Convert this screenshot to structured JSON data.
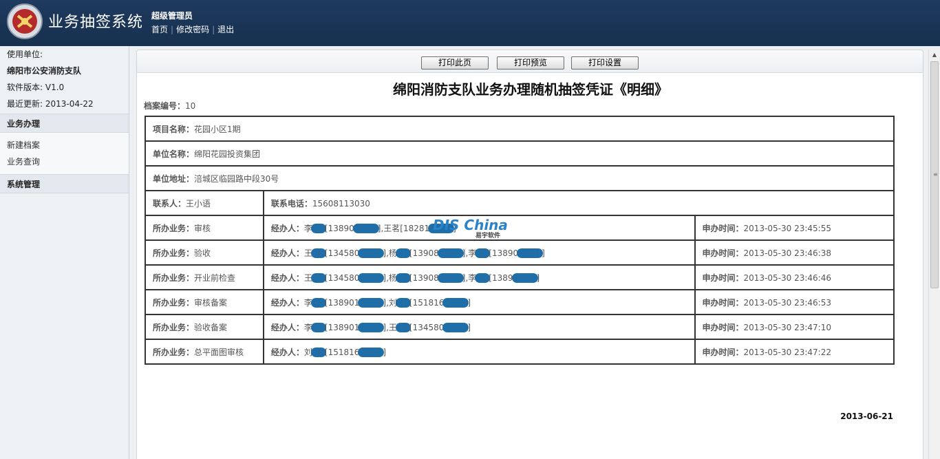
{
  "header": {
    "app_title": "业务抽签系统",
    "user_role": "超级管理员",
    "links": [
      "首页",
      "修改密码",
      "退出"
    ],
    "bg_color": "#1f3a5f"
  },
  "sidebar": {
    "unit_label": "使用单位:",
    "unit_name": "绵阳市公安消防支队",
    "version": "软件版本: V1.0",
    "last_update": "最近更新: 2013-04-22",
    "sections": [
      {
        "title": "业务办理",
        "items": [
          "新建档案",
          "业务查询"
        ]
      },
      {
        "title": "系统管理",
        "items": []
      }
    ]
  },
  "toolbar": {
    "print_page": "打印此页",
    "print_preview": "打印预览",
    "print_setup": "打印设置"
  },
  "document": {
    "title": "绵阳消防支队业务办理随机抽签凭证《明细》",
    "archive_label": "档案编号：",
    "archive_no": "10",
    "project_label": "项目名称：",
    "project_name": "花园小区1期",
    "unit_label": "单位名称：",
    "unit_name": "绵阳花园投资集团",
    "address_label": "单位地址：",
    "address": "涪城区临园路中段30号",
    "contact_label": "联系人：",
    "contact": "王小语",
    "phone_label": "联系电话：",
    "phone": "15608113030",
    "biz_label": "所办业务：",
    "handler_label": "经办人：",
    "time_label": "申办时间：",
    "rows": [
      {
        "business": "审核",
        "time": "2013-05-30 23:45:55"
      },
      {
        "business": "验收",
        "time": "2013-05-30 23:46:38"
      },
      {
        "business": "开业前检查",
        "time": "2013-05-30 23:46:46"
      },
      {
        "business": "审核备案",
        "time": "2013-05-30 23:46:53"
      },
      {
        "business": "验收备案",
        "time": "2013-05-30 23:47:10"
      },
      {
        "business": "总平面图审核",
        "time": "2013-05-30 23:47:22"
      }
    ],
    "date": "2013-06-21"
  },
  "watermark": {
    "brand": "DIS China",
    "sub": "易宇软件"
  }
}
